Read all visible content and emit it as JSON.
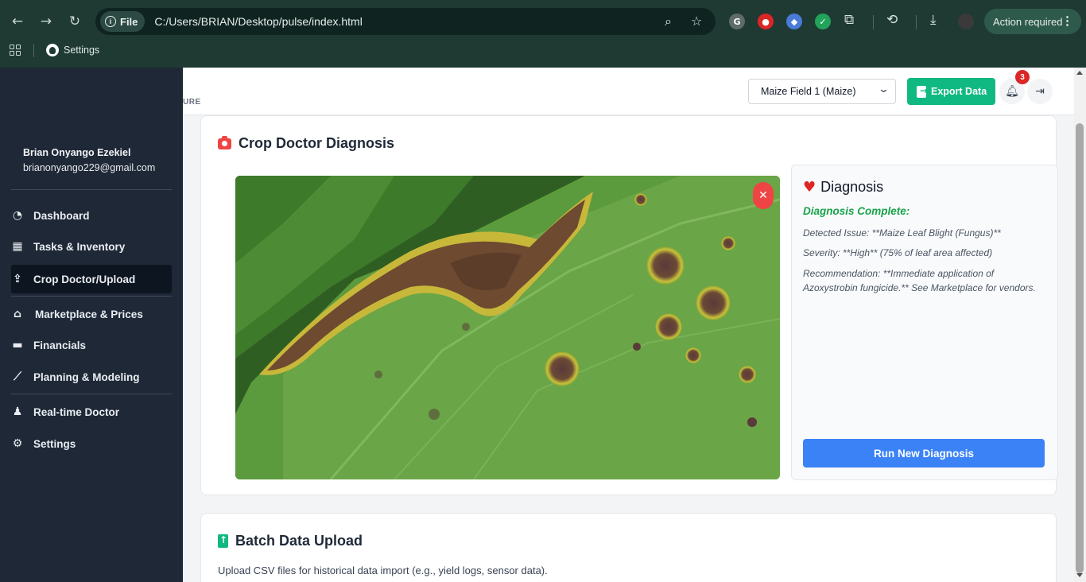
{
  "browser": {
    "file_chip": "File",
    "url": "C:/Users/BRIAN/Desktop/pulse/index.html",
    "action_required": "Action required",
    "bookmark_settings": "Settings"
  },
  "sidebar": {
    "user_name": "Brian Onyango Ezekiel",
    "user_email": "brianonyango229@gmail.com",
    "items": [
      {
        "label": "Dashboard",
        "icon": "gauge-icon"
      },
      {
        "label": "Tasks & Inventory",
        "icon": "calendar-check-icon"
      },
      {
        "label": "Crop Doctor/Upload",
        "icon": "upload-person-icon"
      },
      {
        "label": "Marketplace & Prices",
        "icon": "store-icon"
      },
      {
        "label": "Financials",
        "icon": "wallet-icon"
      },
      {
        "label": "Planning & Modeling",
        "icon": "chart-line-icon"
      },
      {
        "label": "Real-time Doctor",
        "icon": "user-doctor-icon"
      },
      {
        "label": "Settings",
        "icon": "gear-icon"
      }
    ],
    "active_item": "Crop Doctor/Upload"
  },
  "header": {
    "title_fragment": "URE",
    "field_select_value": "Maize Field 1 (Maize)",
    "export_label": "Export Data",
    "notification_count": "3"
  },
  "crop_doctor": {
    "title": "Crop Doctor Diagnosis",
    "diagnosis": {
      "title": "Diagnosis",
      "status": "Diagnosis Complete:",
      "detected": "Detected Issue: **Maize Leaf Blight (Fungus)**",
      "severity": "Severity: **High** (75% of leaf area affected)",
      "recommendation": "Recommendation: **Immediate application of Azoxystrobin fungicide.** See Marketplace for vendors.",
      "run_button": "Run New Diagnosis"
    }
  },
  "batch": {
    "title": "Batch Data Upload",
    "description": "Upload CSV files for historical data import (e.g., yield logs, sensor data)."
  },
  "colors": {
    "sidebar_bg": "#1e2836",
    "export_green": "#10b981",
    "run_blue": "#3b82f6",
    "diagnosis_green": "#16a34a",
    "alert_red": "#ef4444"
  }
}
